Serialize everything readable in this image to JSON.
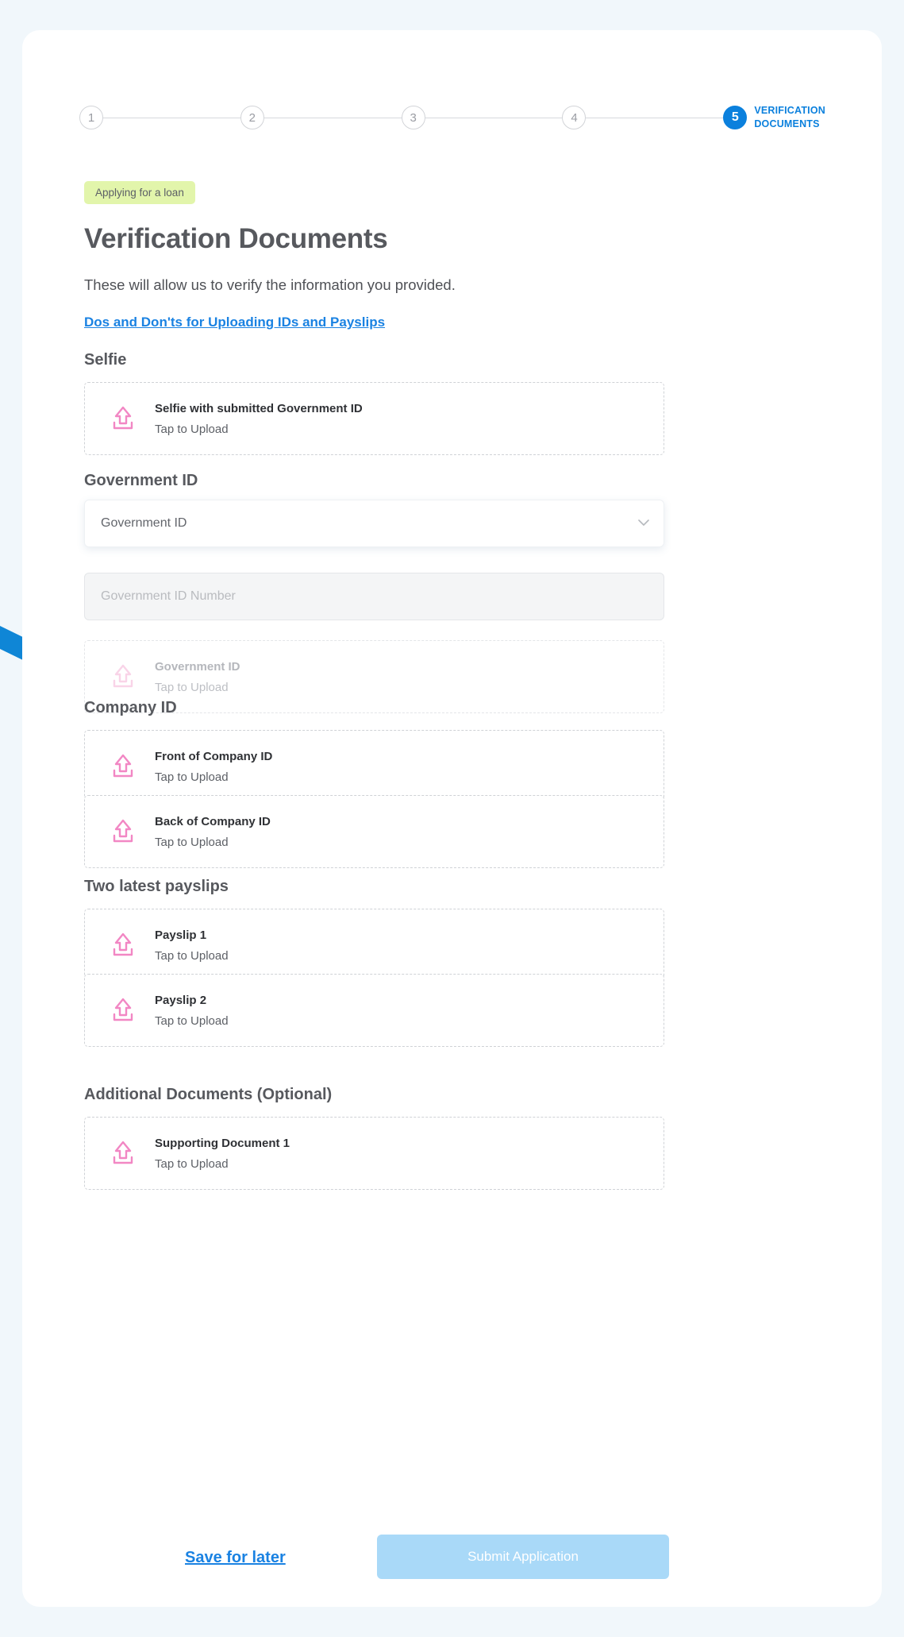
{
  "theme": {
    "page_bg": "#f1f7fb",
    "card_bg": "#ffffff",
    "accent_blue": "#0b80dd",
    "link_blue": "#1a82e2",
    "badge_bg": "#e2f5ab",
    "upload_icon_pink": "#f287c4",
    "upload_icon_pink_disabled": "#f9d4e8",
    "submit_disabled_bg": "#a9d9f8",
    "heading_gray": "#57595e"
  },
  "stepper": {
    "steps": [
      {
        "number": "1",
        "state": "inactive"
      },
      {
        "number": "2",
        "state": "inactive"
      },
      {
        "number": "3",
        "state": "inactive"
      },
      {
        "number": "4",
        "state": "inactive"
      },
      {
        "number": "5",
        "state": "active"
      }
    ],
    "active_label": "VERIFICATION\nDOCUMENTS"
  },
  "header": {
    "badge": "Applying for a loan",
    "title": "Verification Documents",
    "subtitle": "These will allow us to verify the information you provided.",
    "guide_link": "Dos and Don'ts for Uploading IDs and Payslips"
  },
  "sections": {
    "selfie": {
      "heading": "Selfie",
      "upload": {
        "title": "Selfie with submitted Government ID",
        "action": "Tap to Upload",
        "icon": "upload-icon",
        "disabled": false
      }
    },
    "government_id": {
      "heading": "Government ID",
      "select": {
        "value": "Government ID",
        "chevron": "chevron-down-icon"
      },
      "number_field": {
        "placeholder": "Government ID Number",
        "value": "",
        "disabled": true
      },
      "upload": {
        "title": "Government ID",
        "action": "Tap to Upload",
        "icon": "upload-icon",
        "disabled": true
      }
    },
    "company_id": {
      "heading": "Company ID",
      "uploads": [
        {
          "title": "Front of Company ID",
          "action": "Tap to Upload",
          "icon": "upload-icon",
          "disabled": false
        },
        {
          "title": "Back of Company ID",
          "action": "Tap to Upload",
          "icon": "upload-icon",
          "disabled": false
        }
      ]
    },
    "payslips": {
      "heading": "Two latest payslips",
      "uploads": [
        {
          "title": "Payslip 1",
          "action": "Tap to Upload",
          "icon": "upload-icon",
          "disabled": false
        },
        {
          "title": "Payslip 2",
          "action": "Tap to Upload",
          "icon": "upload-icon",
          "disabled": false
        }
      ]
    },
    "additional": {
      "heading": "Additional Documents (Optional)",
      "uploads": [
        {
          "title": "Supporting Document 1",
          "action": "Tap to Upload",
          "icon": "upload-icon",
          "disabled": false
        }
      ]
    }
  },
  "footer": {
    "save_link": "Save for later",
    "submit_label": "Submit Application",
    "submit_enabled": false
  }
}
